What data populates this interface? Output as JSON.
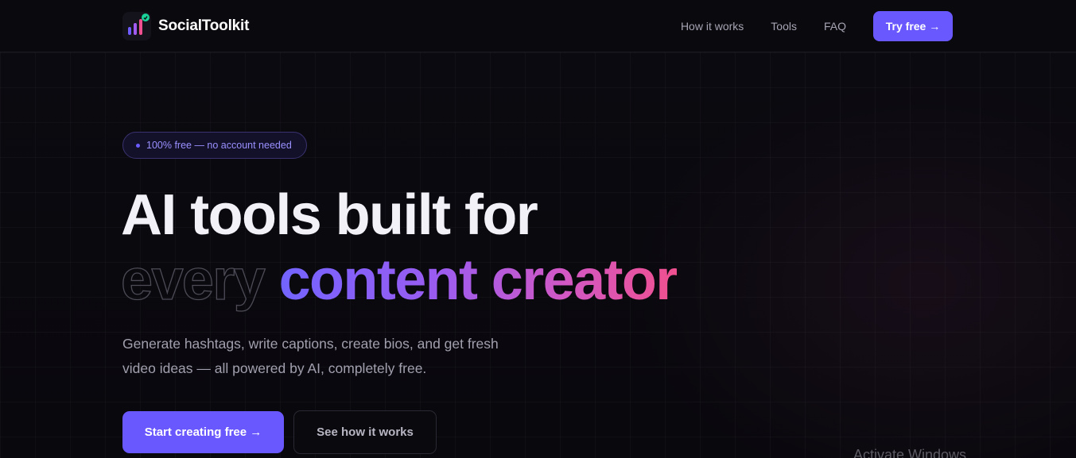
{
  "nav": {
    "brand": "SocialToolkit",
    "links": [
      "How it works",
      "Tools",
      "FAQ"
    ],
    "cta": "Try free →"
  },
  "hero": {
    "badge": "100% free — no account needed",
    "title_line1": "AI tools built for",
    "title_outline_word": "every",
    "title_gradient": "content creator",
    "lead_line1": "Generate hashtags, write captions, create bios, and get fresh",
    "lead_line2": "video ideas — all powered by AI, completely free.",
    "primary_button": "Start creating free →",
    "secondary_button": "See how it works"
  },
  "overlay": {
    "watermark": "Activate Windows"
  },
  "colors": {
    "accent": "#6a58ff",
    "gradient_start": "#7364ff",
    "gradient_end": "#f0508f",
    "background": "#09080d"
  },
  "icons": {
    "logo": "bar-chart-logo-icon",
    "badge": "dot-icon"
  }
}
